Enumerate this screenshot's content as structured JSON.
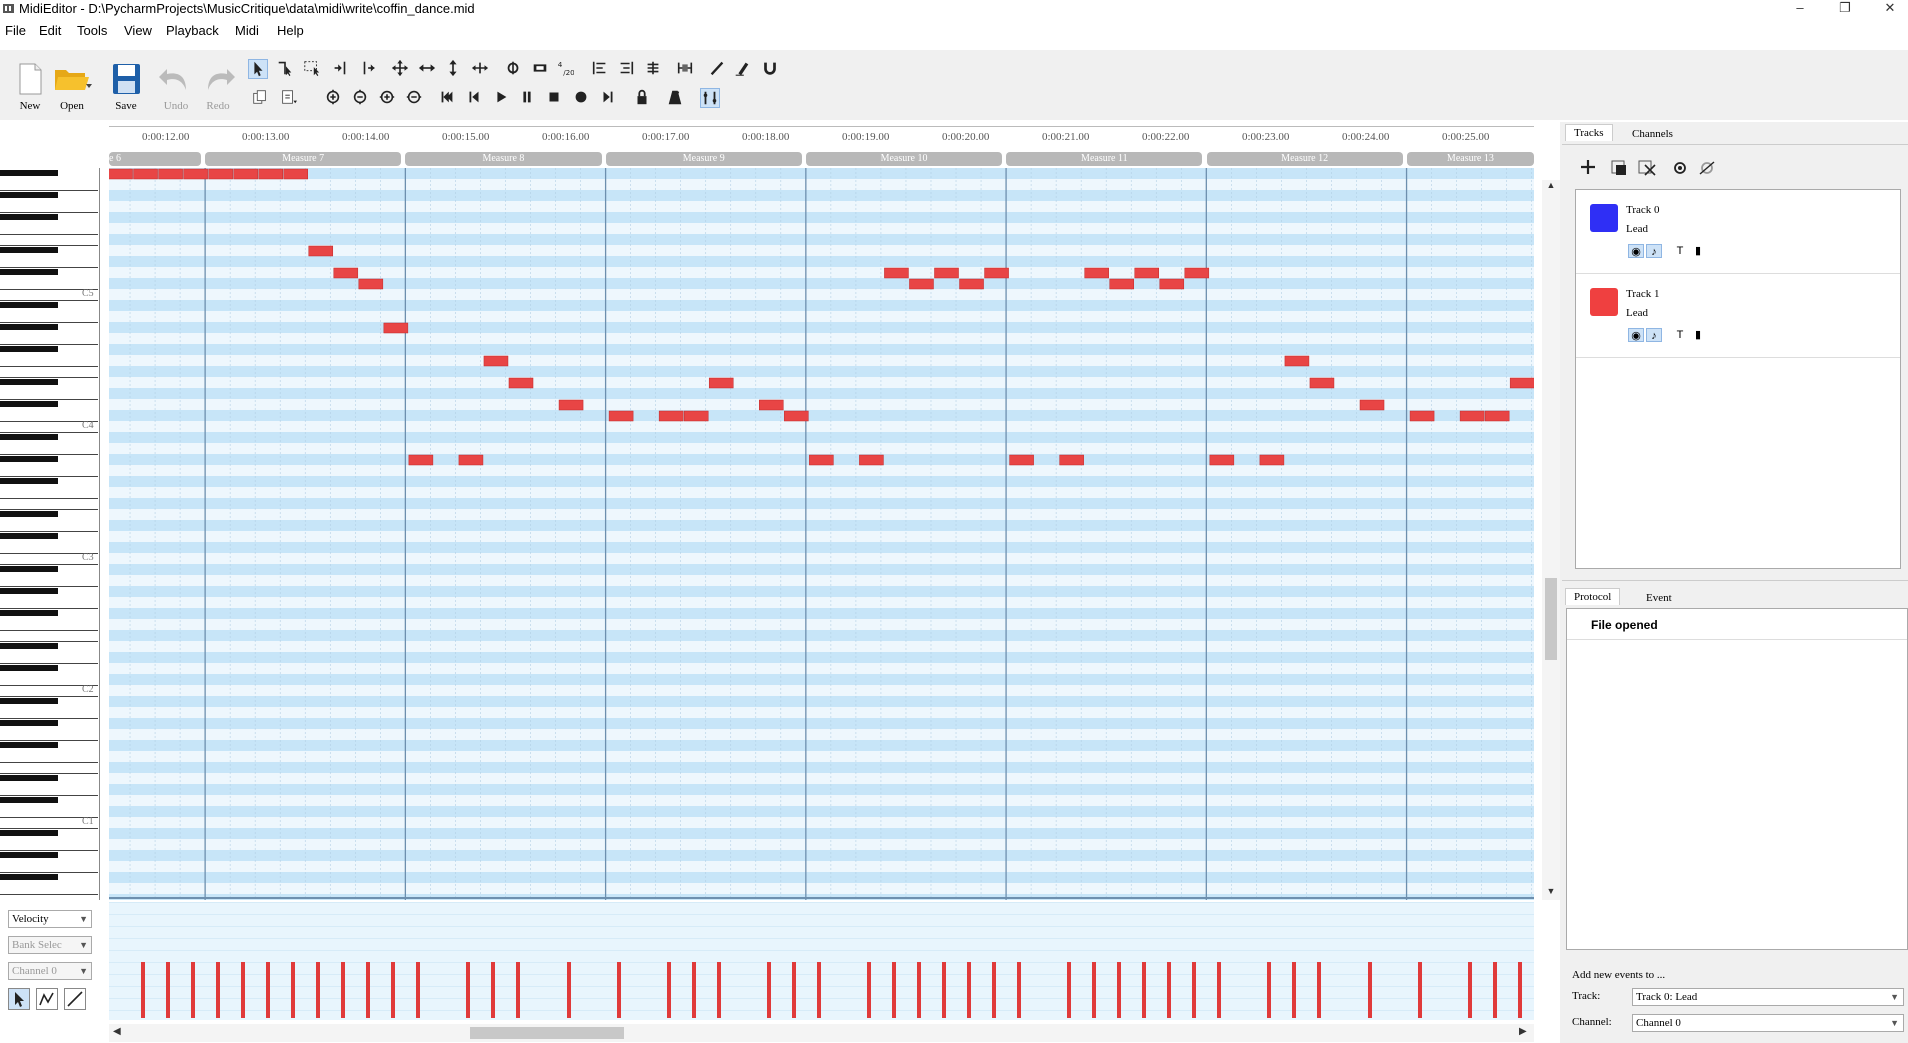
{
  "window": {
    "title": "MidiEditor - D:\\PycharmProjects\\MusicCritique\\data\\midi\\write\\coffin_dance.mid",
    "minimize": "–",
    "restore": "❐",
    "close": "✕"
  },
  "menu": [
    "File",
    "Edit",
    "Tools",
    "View",
    "Playback",
    "Midi",
    "Help"
  ],
  "toolbar": {
    "new_label": "New",
    "open_label": "Open",
    "save_label": "Save",
    "undo_label": "Undo",
    "redo_label": "Redo",
    "row1_icons": [
      "select-icon",
      "select-left-icon",
      "select-box-icon",
      "select-single-icon",
      "select-right-icon",
      "move-all-icon",
      "move-horizontal-icon",
      "move-vertical-icon",
      "resize-icon",
      "tempo-icon",
      "measure-icon",
      "time-signature-icon",
      "align-left-icon",
      "align-right-icon",
      "equalize-icon",
      "quantize-icon",
      "pencil-icon",
      "eraser-icon",
      "magnet-icon"
    ],
    "row2_icons": [
      "copy-icon",
      "paste-icon",
      "zoom-in-vertical-icon",
      "zoom-out-vertical-icon",
      "zoom-in-horizontal-icon",
      "zoom-out-horizontal-icon",
      "skip-start-icon",
      "step-back-icon",
      "play-icon",
      "pause-icon",
      "stop-icon",
      "record-icon",
      "step-forward-icon",
      "lock-icon",
      "metronome-icon",
      "thru-icon"
    ]
  },
  "timeline": {
    "times": [
      "0:00:12.00",
      "0:00:13.00",
      "0:00:14.00",
      "0:00:15.00",
      "0:00:16.00",
      "0:00:17.00",
      "0:00:18.00",
      "0:00:19.00",
      "0:00:20.00",
      "0:00:21.00",
      "0:00:22.00",
      "0:00:23.00",
      "0:00:24.00",
      "0:00:25.00"
    ],
    "measures": [
      "e 6",
      "Measure 7",
      "Measure 8",
      "Measure 9",
      "Measure 10",
      "Measure 11",
      "Measure 12",
      "Measure 13"
    ]
  },
  "piano": {
    "octave_labels": [
      "C5",
      "C4",
      "C3",
      "C2",
      "C1"
    ]
  },
  "notes": {
    "color": "#e84545",
    "beat_unit": "eighth-notes from the left edge of the visible roll",
    "items": [
      {
        "start": 0,
        "len": 1,
        "row": 0
      },
      {
        "start": 1,
        "len": 1,
        "row": 0
      },
      {
        "start": 2,
        "len": 1,
        "row": 0
      },
      {
        "start": 3,
        "len": 1,
        "row": 0
      },
      {
        "start": 4,
        "len": 1,
        "row": 0
      },
      {
        "start": 5,
        "len": 1,
        "row": 0
      },
      {
        "start": 6,
        "len": 1,
        "row": 0
      },
      {
        "start": 7,
        "len": 1,
        "row": 0
      },
      {
        "start": 8,
        "len": 1,
        "row": 7
      },
      {
        "start": 9,
        "len": 1,
        "row": 9
      },
      {
        "start": 10,
        "len": 1,
        "row": 10
      },
      {
        "start": 11,
        "len": 1,
        "row": 14
      },
      {
        "start": 12,
        "len": 1,
        "row": 26
      },
      {
        "start": 14,
        "len": 1,
        "row": 26
      },
      {
        "start": 15,
        "len": 1,
        "row": 17
      },
      {
        "start": 16,
        "len": 1,
        "row": 19
      },
      {
        "start": 18,
        "len": 1,
        "row": 21
      },
      {
        "start": 20,
        "len": 1,
        "row": 22
      },
      {
        "start": 22,
        "len": 1,
        "row": 22
      },
      {
        "start": 23,
        "len": 1,
        "row": 22
      },
      {
        "start": 24,
        "len": 1,
        "row": 19
      },
      {
        "start": 26,
        "len": 1,
        "row": 21
      },
      {
        "start": 27,
        "len": 1,
        "row": 22
      },
      {
        "start": 28,
        "len": 1,
        "row": 26
      },
      {
        "start": 30,
        "len": 1,
        "row": 26
      },
      {
        "start": 31,
        "len": 1,
        "row": 9
      },
      {
        "start": 32,
        "len": 1,
        "row": 10
      },
      {
        "start": 33,
        "len": 1,
        "row": 9
      },
      {
        "start": 34,
        "len": 1,
        "row": 10
      },
      {
        "start": 35,
        "len": 1,
        "row": 9
      },
      {
        "start": 36,
        "len": 1,
        "row": 26
      },
      {
        "start": 38,
        "len": 1,
        "row": 26
      },
      {
        "start": 39,
        "len": 1,
        "row": 9
      },
      {
        "start": 40,
        "len": 1,
        "row": 10
      },
      {
        "start": 41,
        "len": 1,
        "row": 9
      },
      {
        "start": 42,
        "len": 1,
        "row": 10
      },
      {
        "start": 43,
        "len": 1,
        "row": 9
      },
      {
        "start": 44,
        "len": 1,
        "row": 26
      },
      {
        "start": 46,
        "len": 1,
        "row": 26
      },
      {
        "start": 47,
        "len": 1,
        "row": 17
      },
      {
        "start": 48,
        "len": 1,
        "row": 19
      },
      {
        "start": 50,
        "len": 1,
        "row": 21
      },
      {
        "start": 52,
        "len": 1,
        "row": 22
      },
      {
        "start": 54,
        "len": 1,
        "row": 22
      },
      {
        "start": 55,
        "len": 1,
        "row": 22
      },
      {
        "start": 56,
        "len": 1,
        "row": 19
      }
    ]
  },
  "velocity": {
    "bar_color": "#e03a3a",
    "beats": [
      1,
      2,
      3,
      4,
      5,
      6,
      7,
      8,
      9,
      10,
      11,
      12,
      14,
      15,
      16,
      18,
      20,
      22,
      23,
      24,
      26,
      27,
      28,
      30,
      31,
      32,
      33,
      34,
      35,
      36,
      38,
      39,
      40,
      41,
      42,
      43,
      44,
      46,
      47,
      48,
      50,
      52,
      54,
      55,
      56
    ]
  },
  "left_controls": {
    "controller": "Velocity",
    "bank": "Bank Selec",
    "channel": "Channel 0"
  },
  "right": {
    "tabs_top": [
      "Tracks",
      "Channels"
    ],
    "tracks": [
      {
        "name": "Track 0",
        "instrument": "Lead",
        "color": "#2f2ff5"
      },
      {
        "name": "Track 1",
        "instrument": "Lead",
        "color": "#ef4040"
      }
    ],
    "tabs_bottom": [
      "Protocol",
      "Event"
    ],
    "protocol_entry": "File opened",
    "add_events": "Add new events to ...",
    "track_label": "Track:",
    "track_value": "Track 0: Lead",
    "channel_label": "Channel:",
    "channel_value": "Channel 0"
  }
}
